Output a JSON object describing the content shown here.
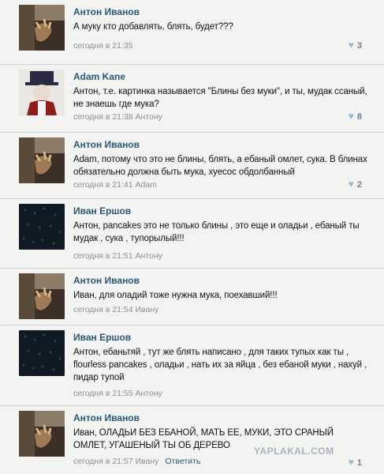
{
  "comments": [
    {
      "author": "Антон Иванов",
      "text": "А муку кто добавлять, блять, будет???",
      "meta": "сегодня в 21:35",
      "reply_to": "",
      "reply_link": "",
      "likes": "3",
      "avatar": "anton"
    },
    {
      "author": "Adam Kane",
      "text": "Антон, т.е. картинка называется \"Блины без муки\", и ты, мудак ссаный, не знаешь где мука?",
      "meta": "сегодня в 21:38 Антону",
      "reply_link": "",
      "likes": "8",
      "avatar": "adam"
    },
    {
      "author": "Антон Иванов",
      "text": "Adam, потому что это не блины, блять, а ебаный омлет, сука. В блинах обязательно должна быть мука, хуесос обдолбанный",
      "meta": "сегодня в 21:41 Adam",
      "reply_link": "",
      "likes": "2",
      "avatar": "anton"
    },
    {
      "author": "Иван Ершов",
      "text": "Антон, pancakes это не только блины , это еще и оладьи , ебаный ты мудак , сука , тупорылый!!!",
      "meta": "сегодня в 21:51 Антону",
      "reply_link": "",
      "likes": "",
      "avatar": "ivan"
    },
    {
      "author": "Антон Иванов",
      "text": "Иван, для оладий тоже нужна мука, поехавший!!!",
      "meta": "сегодня в 21:54 Ивану",
      "reply_link": "",
      "likes": "",
      "avatar": "anton"
    },
    {
      "author": "Иван Ершов",
      "text": "Антон, ебаньтяй , тут же блять написано , для таких тупых как ты , flourless pancakes , оладьи , нать их за яйца , без ебаной муки , нахуй , пидар тупой",
      "meta": "сегодня в 21:55 Антону",
      "reply_link": "",
      "likes": "",
      "avatar": "ivan"
    },
    {
      "author": "Антон Иванов",
      "text": "Иван, ОЛАДЬИ БЕЗ ЕБАНОЙ, МАТЬ ЕЕ, МУКИ, ЭТО СРАНЫЙ ОМЛЕТ, УГАШЕНЫЙ ТЫ ОБ ДЕРЕВО",
      "meta": "сегодня в 21:57 Ивану",
      "reply_link": "Ответить",
      "likes": "1",
      "avatar": "anton"
    }
  ],
  "watermark": "YAPLAKAL.COM"
}
